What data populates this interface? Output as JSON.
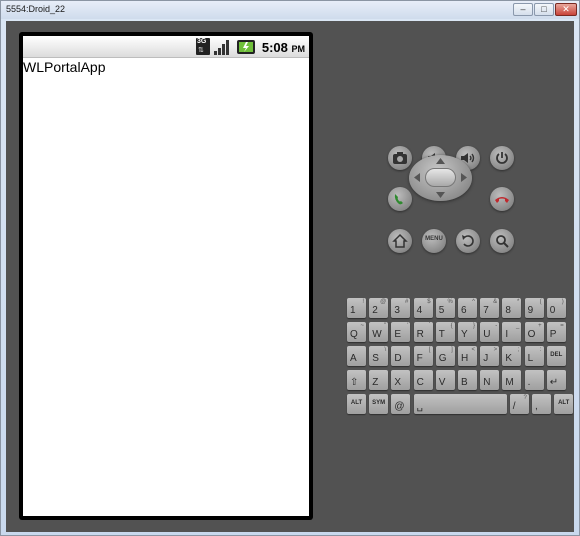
{
  "window": {
    "title": "5554:Droid_22",
    "minimize": "–",
    "maximize": "□",
    "close": "✕"
  },
  "statusbar": {
    "network_badge": "3G",
    "time": "5:08",
    "ampm": "PM"
  },
  "app": {
    "title": "WLPortalApp"
  },
  "controls": {
    "menu_label": "MENU",
    "buttons": [
      "camera",
      "volume-down",
      "volume-up",
      "power",
      "call",
      "dpad",
      "end-call",
      "home",
      "menu",
      "back",
      "search"
    ]
  },
  "keyboard": {
    "rows": [
      [
        {
          "k": "1",
          "a": "!"
        },
        {
          "k": "2",
          "a": "@"
        },
        {
          "k": "3",
          "a": "#"
        },
        {
          "k": "4",
          "a": "$"
        },
        {
          "k": "5",
          "a": "%"
        },
        {
          "k": "6",
          "a": "^"
        },
        {
          "k": "7",
          "a": "&"
        },
        {
          "k": "8",
          "a": "*"
        },
        {
          "k": "9",
          "a": "("
        },
        {
          "k": "0",
          "a": ")"
        }
      ],
      [
        {
          "k": "Q",
          "a": "~"
        },
        {
          "k": "W",
          "a": "\""
        },
        {
          "k": "E",
          "a": "'"
        },
        {
          "k": "R",
          "a": "`"
        },
        {
          "k": "T",
          "a": "{"
        },
        {
          "k": "Y",
          "a": "}"
        },
        {
          "k": "U",
          "a": "-"
        },
        {
          "k": "I",
          "a": "_"
        },
        {
          "k": "O",
          "a": "+"
        },
        {
          "k": "P",
          "a": "="
        }
      ],
      [
        {
          "k": "A",
          "a": ""
        },
        {
          "k": "S",
          "a": "\\"
        },
        {
          "k": "D",
          "a": ""
        },
        {
          "k": "F",
          "a": "["
        },
        {
          "k": "G",
          "a": "]"
        },
        {
          "k": "H",
          "a": "<"
        },
        {
          "k": "J",
          "a": ">"
        },
        {
          "k": "K",
          "a": ";"
        },
        {
          "k": "L",
          "a": ":"
        },
        {
          "k": "DEL",
          "a": ""
        }
      ],
      [
        {
          "k": "⇧",
          "a": ""
        },
        {
          "k": "Z",
          "a": ""
        },
        {
          "k": "X",
          "a": ""
        },
        {
          "k": "C",
          "a": ""
        },
        {
          "k": "V",
          "a": ""
        },
        {
          "k": "B",
          "a": ""
        },
        {
          "k": "N",
          "a": ""
        },
        {
          "k": "M",
          "a": ""
        },
        {
          "k": ".",
          "a": ""
        },
        {
          "k": "↵",
          "a": ""
        }
      ],
      [
        {
          "k": "ALT",
          "a": ""
        },
        {
          "k": "SYM",
          "a": ""
        },
        {
          "k": "@",
          "a": ""
        },
        {
          "k": "␣",
          "a": ""
        },
        {
          "k": "/",
          "a": "?"
        },
        {
          "k": ",",
          "a": ""
        },
        {
          "k": "ALT",
          "a": ""
        }
      ]
    ]
  }
}
